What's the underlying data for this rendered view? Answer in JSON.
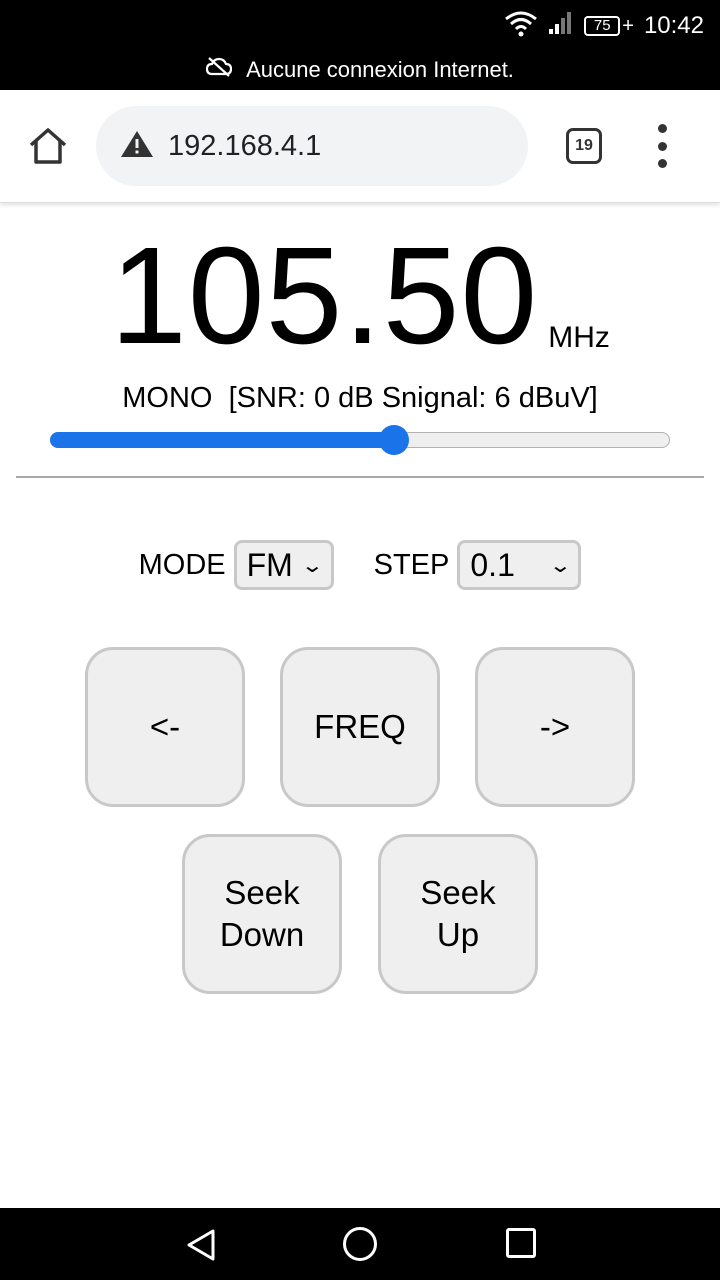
{
  "status_bar": {
    "battery": "75",
    "time": "10:42",
    "connection_message": "Aucune connexion Internet."
  },
  "browser": {
    "url": "192.168.4.1",
    "tab_count": "19"
  },
  "radio": {
    "frequency": "105.50",
    "unit": "MHz",
    "signal_info": "MONO  [SNR: 0 dB Snignal: 6 dBuV]",
    "slider_fraction": 0.555
  },
  "controls": {
    "mode_label": "MODE",
    "mode_value": "FM",
    "step_label": "STEP",
    "step_value": "0.1",
    "buttons": {
      "prev": "<-",
      "freq": "FREQ",
      "next": "->",
      "seek_down": "Seek\nDown",
      "seek_up": "Seek\nUp"
    }
  }
}
